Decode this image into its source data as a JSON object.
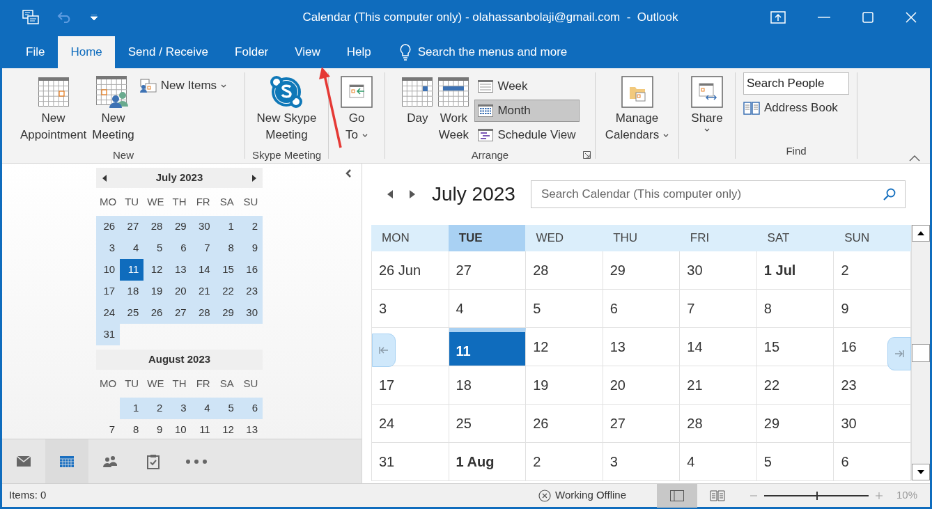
{
  "window": {
    "title": "Calendar (This computer only) - olahassanbolaji@gmail.com  -  Outlook"
  },
  "quick_access": [
    {
      "kind": "send-receive"
    },
    {
      "kind": "undo",
      "disabled": true
    },
    {
      "kind": "customize"
    }
  ],
  "tabs": [
    {
      "label": "File",
      "selected": false
    },
    {
      "label": "Home",
      "selected": true
    },
    {
      "label": "Send / Receive",
      "selected": false
    },
    {
      "label": "Folder",
      "selected": false
    },
    {
      "label": "View",
      "selected": false
    },
    {
      "label": "Help",
      "selected": false
    }
  ],
  "tell_me": {
    "placeholder": "Search the menus and more"
  },
  "ribbon": {
    "groups": [
      {
        "label": "New",
        "items": [
          {
            "kind": "big",
            "label": "New\nAppointment",
            "dropdown": false
          },
          {
            "kind": "big",
            "label": "New\nMeeting",
            "dropdown": false
          },
          {
            "kind": "small",
            "label": "New Items",
            "dropdown": true
          }
        ]
      },
      {
        "label": "Skype Meeting",
        "items": [
          {
            "kind": "big",
            "label": "New Skype\nMeeting",
            "dropdown": false
          }
        ]
      },
      {
        "items": [
          {
            "kind": "big",
            "label": "Go\nTo",
            "dropdown": true
          }
        ]
      },
      {
        "label": "Arrange",
        "launcher": true,
        "items": [
          {
            "kind": "big",
            "label": "Day",
            "selected": false,
            "dropdown": false
          },
          {
            "kind": "big",
            "label": "Work\nWeek",
            "selected": false,
            "dropdown": false
          },
          {
            "kind": "stack",
            "entries": [
              {
                "label": "Week",
                "selected": false
              },
              {
                "label": "Month",
                "selected": true
              },
              {
                "label": "Schedule View",
                "selected": false
              }
            ]
          }
        ]
      },
      {
        "items": [
          {
            "kind": "big",
            "label": "Manage\nCalendars",
            "dropdown": true
          }
        ]
      },
      {
        "items": [
          {
            "kind": "big",
            "label": "Share",
            "dropdown": true
          }
        ]
      },
      {
        "label": "Find",
        "items": [
          {
            "kind": "find",
            "search_placeholder": "Search People",
            "address_book": "Address Book"
          }
        ]
      }
    ]
  },
  "mini_calendars": [
    {
      "title": "July 2023",
      "arrows": true,
      "weekdays": [
        "MO",
        "TU",
        "WE",
        "TH",
        "FR",
        "SA",
        "SU"
      ],
      "weeks": [
        [
          {
            "day": "26",
            "in_view": true,
            "selected": false
          },
          {
            "day": "27",
            "in_view": true,
            "selected": false
          },
          {
            "day": "28",
            "in_view": true,
            "selected": false
          },
          {
            "day": "29",
            "in_view": true,
            "selected": false
          },
          {
            "day": "30",
            "in_view": true,
            "selected": false
          },
          {
            "day": "1",
            "in_view": true,
            "selected": false
          },
          {
            "day": "2",
            "in_view": true,
            "selected": false
          }
        ],
        [
          {
            "day": "3",
            "in_view": true,
            "selected": false
          },
          {
            "day": "4",
            "in_view": true,
            "selected": false
          },
          {
            "day": "5",
            "in_view": true,
            "selected": false
          },
          {
            "day": "6",
            "in_view": true,
            "selected": false
          },
          {
            "day": "7",
            "in_view": true,
            "selected": false
          },
          {
            "day": "8",
            "in_view": true,
            "selected": false
          },
          {
            "day": "9",
            "in_view": true,
            "selected": false
          }
        ],
        [
          {
            "day": "10",
            "in_view": true,
            "selected": false
          },
          {
            "day": "11",
            "selected": true
          },
          {
            "day": "12",
            "in_view": true,
            "selected": false
          },
          {
            "day": "13",
            "in_view": true,
            "selected": false
          },
          {
            "day": "14",
            "in_view": true,
            "selected": false
          },
          {
            "day": "15",
            "in_view": true,
            "selected": false
          },
          {
            "day": "16",
            "in_view": true,
            "selected": false
          }
        ],
        [
          {
            "day": "17",
            "in_view": true,
            "selected": false
          },
          {
            "day": "18",
            "in_view": true,
            "selected": false
          },
          {
            "day": "19",
            "in_view": true,
            "selected": false
          },
          {
            "day": "20",
            "in_view": true,
            "selected": false
          },
          {
            "day": "21",
            "in_view": true,
            "selected": false
          },
          {
            "day": "22",
            "in_view": true,
            "selected": false
          },
          {
            "day": "23",
            "in_view": true,
            "selected": false
          }
        ],
        [
          {
            "day": "24",
            "in_view": true,
            "selected": false
          },
          {
            "day": "25",
            "in_view": true,
            "selected": false
          },
          {
            "day": "26",
            "in_view": true,
            "selected": false
          },
          {
            "day": "27",
            "in_view": true,
            "selected": false
          },
          {
            "day": "28",
            "in_view": true,
            "selected": false
          },
          {
            "day": "29",
            "in_view": true,
            "selected": false
          },
          {
            "day": "30",
            "in_view": true,
            "selected": false
          }
        ],
        [
          {
            "day": "31",
            "in_view": true,
            "selected": false
          }
        ]
      ]
    },
    {
      "title": "August 2023",
      "arrows": false,
      "weekdays": [
        "MO",
        "TU",
        "WE",
        "TH",
        "FR",
        "SA",
        "SU"
      ],
      "weeks": [
        [
          {
            "day": "1",
            "in_view": true,
            "selected": false
          },
          {
            "day": "2",
            "in_view": true,
            "selected": false
          },
          {
            "day": "3",
            "in_view": true,
            "selected": false
          },
          {
            "day": "4",
            "in_view": true,
            "selected": false
          },
          {
            "day": "5",
            "in_view": true,
            "selected": false
          },
          {
            "day": "6",
            "in_view": true,
            "selected": false
          }
        ],
        [
          {
            "day": "7",
            "in_view": false,
            "selected": false
          },
          {
            "day": "8",
            "in_view": false,
            "selected": false
          },
          {
            "day": "9",
            "in_view": false,
            "selected": false
          },
          {
            "day": "10",
            "in_view": false,
            "selected": false
          },
          {
            "day": "11",
            "in_view": false,
            "selected": false
          },
          {
            "day": "12",
            "in_view": false,
            "selected": false
          },
          {
            "day": "13",
            "in_view": false,
            "selected": false
          }
        ]
      ]
    }
  ],
  "nav_bar": [
    {
      "kind": "mail",
      "selected": false
    },
    {
      "kind": "calendar",
      "selected": true
    },
    {
      "kind": "people",
      "selected": false
    },
    {
      "kind": "tasks",
      "selected": false
    },
    {
      "kind": "more",
      "selected": false
    }
  ],
  "calendar": {
    "title": "July 2023",
    "search": {
      "placeholder": "Search Calendar (This computer only)"
    },
    "columns": [
      {
        "label": "MON",
        "selected": false
      },
      {
        "label": "TUE",
        "selected": true
      },
      {
        "label": "WED",
        "selected": false
      },
      {
        "label": "THU",
        "selected": false
      },
      {
        "label": "FRI",
        "selected": false
      },
      {
        "label": "SAT",
        "selected": false
      },
      {
        "label": "SUN",
        "selected": false
      }
    ],
    "weeks": [
      [
        {
          "label": "26 Jun",
          "bold": false,
          "today": false
        },
        {
          "label": "27",
          "bold": false,
          "today": false
        },
        {
          "label": "28",
          "bold": false,
          "today": false
        },
        {
          "label": "29",
          "bold": false,
          "today": false
        },
        {
          "label": "30",
          "bold": false,
          "today": false
        },
        {
          "label": "1 Jul",
          "bold": true,
          "today": false
        },
        {
          "label": "2",
          "bold": false,
          "today": false
        }
      ],
      [
        {
          "label": "3",
          "bold": false,
          "today": false
        },
        {
          "label": "4",
          "bold": false,
          "today": false
        },
        {
          "label": "5",
          "bold": false,
          "today": false
        },
        {
          "label": "6",
          "bold": false,
          "today": false
        },
        {
          "label": "7",
          "bold": false,
          "today": false
        },
        {
          "label": "8",
          "bold": false,
          "today": false
        },
        {
          "label": "9",
          "bold": false,
          "today": false
        }
      ],
      [
        {
          "label": "11",
          "bold": true,
          "today": true
        },
        {
          "label": "12",
          "bold": false,
          "today": false
        },
        {
          "label": "13",
          "bold": false,
          "today": false
        },
        {
          "label": "14",
          "bold": false,
          "today": false
        },
        {
          "label": "15",
          "bold": false,
          "today": false
        },
        {
          "label": "16",
          "bold": false,
          "today": false
        }
      ],
      [
        {
          "label": "17",
          "bold": false,
          "today": false
        },
        {
          "label": "18",
          "bold": false,
          "today": false
        },
        {
          "label": "19",
          "bold": false,
          "today": false
        },
        {
          "label": "20",
          "bold": false,
          "today": false
        },
        {
          "label": "21",
          "bold": false,
          "today": false
        },
        {
          "label": "22",
          "bold": false,
          "today": false
        },
        {
          "label": "23",
          "bold": false,
          "today": false
        }
      ],
      [
        {
          "label": "24",
          "bold": false,
          "today": false
        },
        {
          "label": "25",
          "bold": false,
          "today": false
        },
        {
          "label": "26",
          "bold": false,
          "today": false
        },
        {
          "label": "27",
          "bold": false,
          "today": false
        },
        {
          "label": "28",
          "bold": false,
          "today": false
        },
        {
          "label": "29",
          "bold": false,
          "today": false
        },
        {
          "label": "30",
          "bold": false,
          "today": false
        }
      ],
      [
        {
          "label": "31",
          "bold": false,
          "today": false
        },
        {
          "label": "1 Aug",
          "bold": true,
          "today": false
        },
        {
          "label": "2",
          "bold": false,
          "today": false
        },
        {
          "label": "3",
          "bold": false,
          "today": false
        },
        {
          "label": "4",
          "bold": false,
          "today": false
        },
        {
          "label": "5",
          "bold": false,
          "today": false
        },
        {
          "label": "6",
          "bold": false,
          "today": false
        }
      ]
    ]
  },
  "status_bar": {
    "items": "Items: 0",
    "offline": "Working Offline",
    "views": [
      {
        "kind": "normal",
        "selected": true
      },
      {
        "kind": "reading",
        "selected": false
      }
    ],
    "zoom": {
      "level": 0.5,
      "reading": "10%"
    }
  }
}
